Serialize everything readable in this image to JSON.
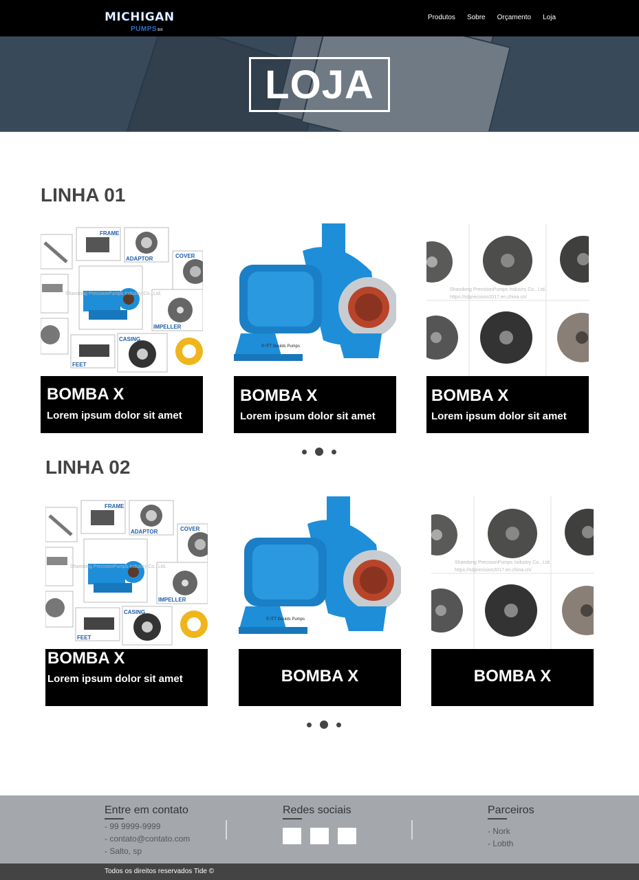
{
  "nav": {
    "logo_main": "MICHIGAN",
    "logo_sub": "PUMPS",
    "logo_suffix": "BR",
    "links": [
      "Produtos",
      "Sobre",
      "Orçamento",
      "Loja"
    ]
  },
  "hero": {
    "title": "LOJA"
  },
  "sections": [
    {
      "title": "LINHA 01",
      "products": [
        {
          "title": "BOMBA X",
          "desc": "Lorem ipsum dolor sit amet",
          "image": "pump-parts-diagram"
        },
        {
          "title": "BOMBA X",
          "desc": "Lorem ipsum dolor sit amet",
          "image": "blue-centrifugal-pump"
        },
        {
          "title": "BOMBA X",
          "desc": "Lorem ipsum dolor sit amet",
          "image": "impellers-grid"
        }
      ]
    },
    {
      "title": "LINHA 02",
      "products": [
        {
          "title": "BOMBA X",
          "desc": "Lorem ipsum dolor sit amet",
          "image": "pump-parts-diagram"
        },
        {
          "title": "BOMBA X",
          "desc": "",
          "image": "blue-centrifugal-pump"
        },
        {
          "title": "BOMBA X",
          "desc": "",
          "image": "impellers-grid"
        }
      ]
    }
  ],
  "image_text": {
    "labels": [
      "FRAME",
      "ADAPTOR",
      "COVER",
      "IMPELLER",
      "CASING",
      "FEET"
    ],
    "pump_credit": "© ITT Goulds Pumps",
    "watermark_1": "Shandong PrecisionPumps Industry Co., Ltd.",
    "watermark_2": "https://sdprecision2017.en.china.cn/"
  },
  "footer": {
    "contact": {
      "title": "Entre em contato",
      "items": [
        "- 99 9999-9999",
        "- contato@contato.com",
        "- Salto, sp"
      ]
    },
    "social": {
      "title": "Redes sociais"
    },
    "partners": {
      "title": "Parceiros",
      "items": [
        "- Nork",
        "- Lobth"
      ]
    },
    "copyright": "Todos os direitos reservados Tide ©"
  },
  "colors": {
    "navbar": "#000000",
    "hero_bg": "#38495a",
    "pump_blue": "#1e8ed8",
    "footer_bg": "#a4a8ad",
    "bottom_bar": "#444444"
  }
}
